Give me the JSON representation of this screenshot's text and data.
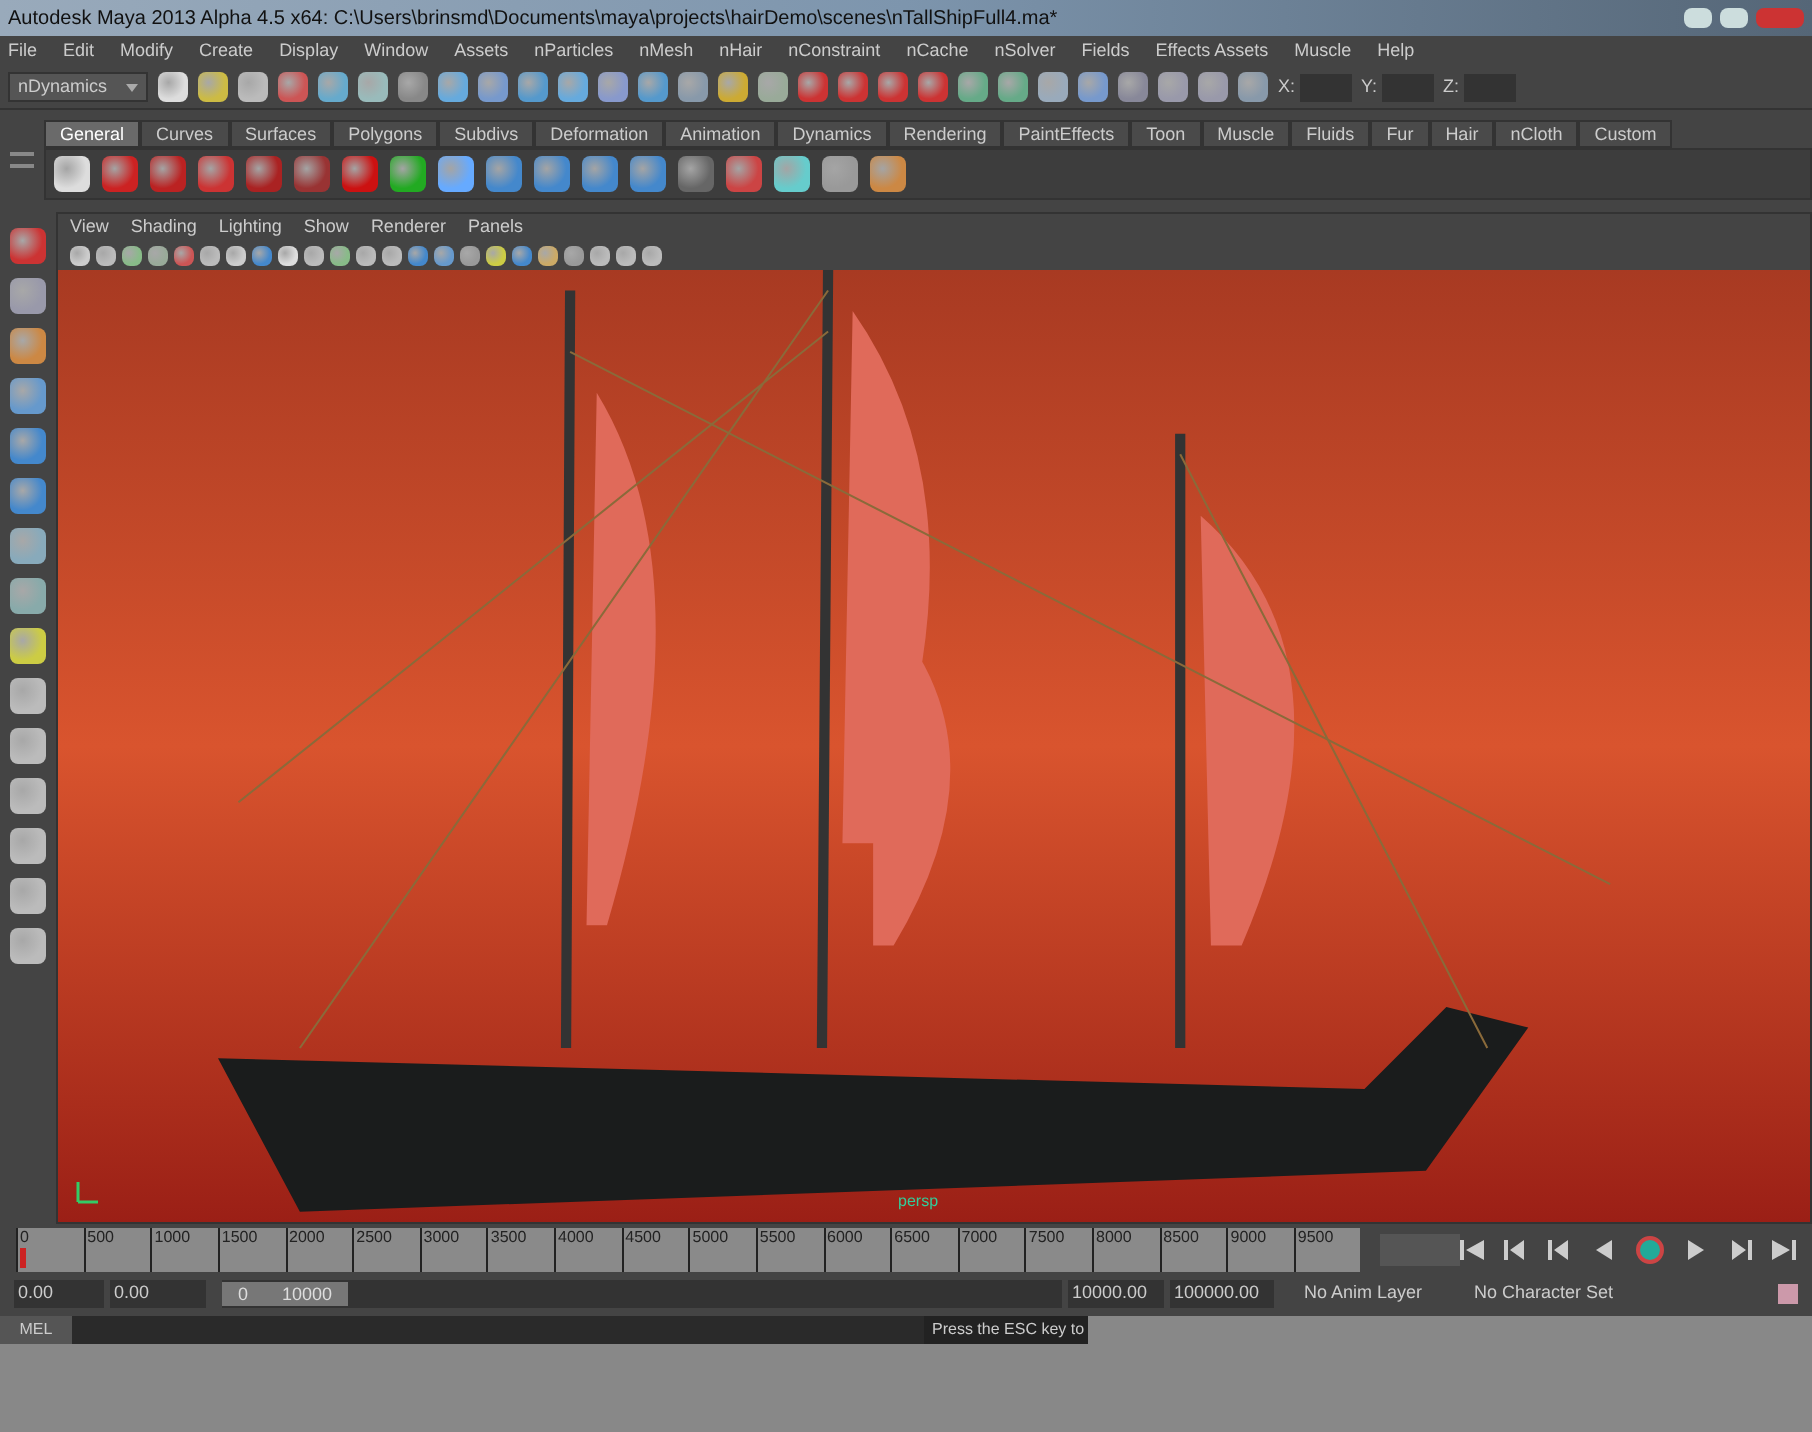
{
  "window": {
    "title": "Autodesk Maya 2013 Alpha 4.5 x64: C:\\Users\\brinsmd\\Documents\\maya\\projects\\hairDemo\\scenes\\nTallShipFull4.ma*"
  },
  "menu": [
    "File",
    "Edit",
    "Modify",
    "Create",
    "Display",
    "Window",
    "Assets",
    "nParticles",
    "nMesh",
    "nHair",
    "nConstraint",
    "nCache",
    "nSolver",
    "Fields",
    "Effects Assets",
    "Muscle",
    "Help"
  ],
  "status_line": {
    "menu_set": "nDynamics",
    "fields": [
      {
        "label": "X:"
      },
      {
        "label": "Y:"
      },
      {
        "label": "Z:"
      }
    ]
  },
  "shelf_tabs": [
    {
      "label": "General",
      "selected": true
    },
    {
      "label": "Curves",
      "selected": false
    },
    {
      "label": "Surfaces",
      "selected": false
    },
    {
      "label": "Polygons",
      "selected": false
    },
    {
      "label": "Subdivs",
      "selected": false
    },
    {
      "label": "Deformation",
      "selected": false
    },
    {
      "label": "Animation",
      "selected": false
    },
    {
      "label": "Dynamics",
      "selected": false
    },
    {
      "label": "Rendering",
      "selected": false
    },
    {
      "label": "PaintEffects",
      "selected": false
    },
    {
      "label": "Toon",
      "selected": false
    },
    {
      "label": "Muscle",
      "selected": false
    },
    {
      "label": "Fluids",
      "selected": false
    },
    {
      "label": "Fur",
      "selected": false
    },
    {
      "label": "Hair",
      "selected": false
    },
    {
      "label": "nCloth",
      "selected": false
    },
    {
      "label": "Custom",
      "selected": false
    }
  ],
  "panel_menu": [
    "View",
    "Shading",
    "Lighting",
    "Show",
    "Renderer",
    "Panels"
  ],
  "viewport": {
    "camera": "persp"
  },
  "time_slider": {
    "level": 0,
    "ticks": [
      "0",
      "500",
      "1000",
      "1500",
      "2000",
      "2500",
      "3000",
      "3500",
      "4000",
      "4500",
      "5000",
      "5500",
      "6000",
      "6500",
      "7000",
      "7500",
      "8000",
      "8500",
      "9000",
      "9500"
    ]
  },
  "range_slider": {
    "level": 0.15,
    "start_time": "0.00",
    "playback_start": "0.00",
    "range_start": "0",
    "range_end": "10000",
    "playback_end": "10000.00",
    "end_time": "100000.00",
    "anim_layer": "No Anim Layer",
    "character_set": "No Character Set"
  },
  "command_line": {
    "language": "MEL",
    "help": "Press the ESC key to"
  }
}
